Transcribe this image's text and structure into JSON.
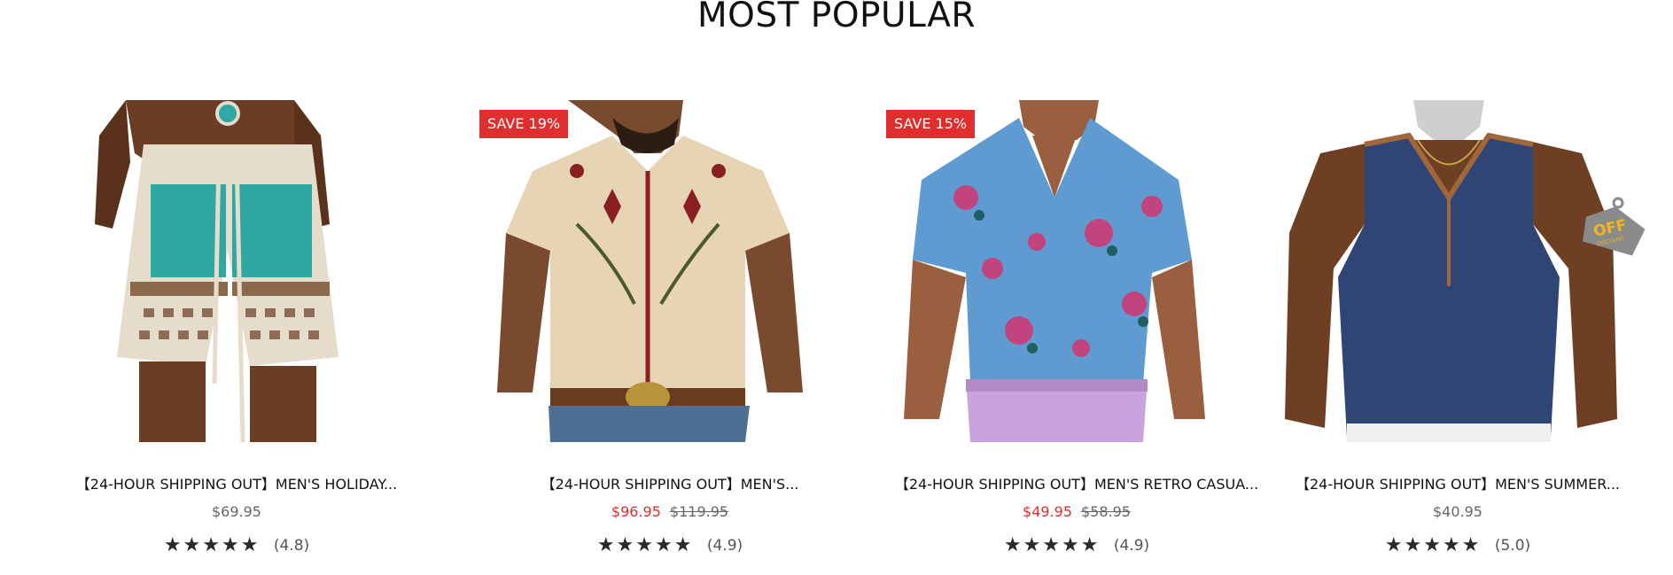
{
  "section": {
    "title": "MOST POPULAR"
  },
  "products": [
    {
      "badge": "",
      "title": "【24-HOUR SHIPPING OUT】MEN'S HOLIDAY...",
      "price": "$69.95",
      "old_price": "",
      "stars": "★★★★★",
      "rating": "(4.8)",
      "image_icon": "crochet-shorts-image"
    },
    {
      "badge": "SAVE 19%",
      "title": "【24-HOUR SHIPPING OUT】MEN'S...",
      "price": "$96.95",
      "old_price": "$119.95",
      "stars": "★★★★★",
      "rating": "(4.9)",
      "image_icon": "embroidered-shirt-image"
    },
    {
      "badge": "SAVE 15%",
      "title": "【24-HOUR SHIPPING OUT】MEN'S RETRO CASUA...",
      "price": "$49.95",
      "old_price": "$58.95",
      "stars": "★★★★★",
      "rating": "(4.9)",
      "image_icon": "floral-shirt-image"
    },
    {
      "badge": "",
      "title": "【24-HOUR SHIPPING OUT】MEN'S SUMMER...",
      "price": "$40.95",
      "old_price": "",
      "stars": "★★★★★",
      "rating": "(5.0)",
      "image_icon": "tank-top-image",
      "tag_text": "OFF",
      "tag_sub": "DISCOUNT"
    }
  ],
  "colors": {
    "sale": "#e02e2e",
    "stars": "#2a2a2a",
    "tag": "#8a8a8a",
    "tag_text": "#f2b51b"
  }
}
